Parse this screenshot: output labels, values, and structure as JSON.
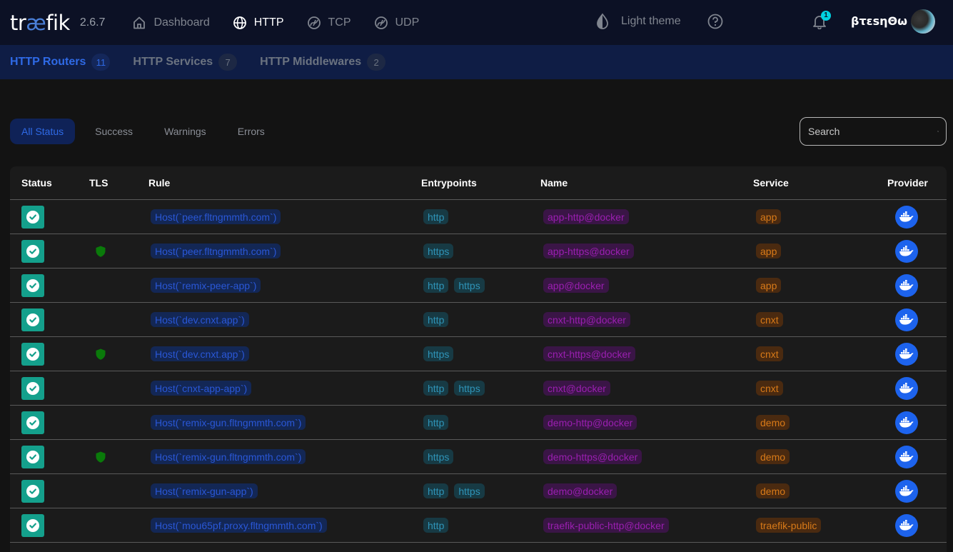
{
  "header": {
    "logo_prefix": "tr",
    "logo_ae": "æ",
    "logo_suffix": "fik",
    "version": "2.6.7",
    "nav": [
      {
        "label": "Dashboard",
        "icon": "home-icon",
        "active": false
      },
      {
        "label": "HTTP",
        "icon": "globe-icon",
        "active": true
      },
      {
        "label": "TCP",
        "icon": "tcp-icon",
        "active": false
      },
      {
        "label": "UDP",
        "icon": "udp-icon",
        "active": false
      }
    ],
    "theme_toggle_label": "Light theme",
    "notification_count": "1",
    "username": "βτεsηΘω"
  },
  "subnav": {
    "tabs": [
      {
        "label": "HTTP Routers",
        "count": "11",
        "active": true
      },
      {
        "label": "HTTP Services",
        "count": "7",
        "active": false
      },
      {
        "label": "HTTP Middlewares",
        "count": "2",
        "active": false
      }
    ]
  },
  "filters": {
    "options": [
      "All Status",
      "Success",
      "Warnings",
      "Errors"
    ],
    "selected": "All Status"
  },
  "search": {
    "placeholder": "Search",
    "value": ""
  },
  "colors": {
    "accent": "#2f6ae6",
    "success": "#14a08c",
    "tls_shield": "#0a7a0a",
    "docker_blue": "#1d63ed"
  },
  "table": {
    "columns": [
      "Status",
      "TLS",
      "Rule",
      "Entrypoints",
      "Name",
      "Service",
      "Provider"
    ],
    "rows": [
      {
        "status": "success",
        "tls": false,
        "rule": "Host(`peer.fltngmmth.com`)",
        "entrypoints": [
          "http"
        ],
        "name": "app-http@docker",
        "service": "app",
        "provider": "docker"
      },
      {
        "status": "success",
        "tls": true,
        "rule": "Host(`peer.fltngmmth.com`)",
        "entrypoints": [
          "https"
        ],
        "name": "app-https@docker",
        "service": "app",
        "provider": "docker"
      },
      {
        "status": "success",
        "tls": false,
        "rule": "Host(`remix-peer-app`)",
        "entrypoints": [
          "http",
          "https"
        ],
        "name": "app@docker",
        "service": "app",
        "provider": "docker"
      },
      {
        "status": "success",
        "tls": false,
        "rule": "Host(`dev.cnxt.app`)",
        "entrypoints": [
          "http"
        ],
        "name": "cnxt-http@docker",
        "service": "cnxt",
        "provider": "docker"
      },
      {
        "status": "success",
        "tls": true,
        "rule": "Host(`dev.cnxt.app`)",
        "entrypoints": [
          "https"
        ],
        "name": "cnxt-https@docker",
        "service": "cnxt",
        "provider": "docker"
      },
      {
        "status": "success",
        "tls": false,
        "rule": "Host(`cnxt-app-app`)",
        "entrypoints": [
          "http",
          "https"
        ],
        "name": "cnxt@docker",
        "service": "cnxt",
        "provider": "docker"
      },
      {
        "status": "success",
        "tls": false,
        "rule": "Host(`remix-gun.fltngmmth.com`)",
        "entrypoints": [
          "http"
        ],
        "name": "demo-http@docker",
        "service": "demo",
        "provider": "docker"
      },
      {
        "status": "success",
        "tls": true,
        "rule": "Host(`remix-gun.fltngmmth.com`)",
        "entrypoints": [
          "https"
        ],
        "name": "demo-https@docker",
        "service": "demo",
        "provider": "docker"
      },
      {
        "status": "success",
        "tls": false,
        "rule": "Host(`remix-gun-app`)",
        "entrypoints": [
          "http",
          "https"
        ],
        "name": "demo@docker",
        "service": "demo",
        "provider": "docker"
      },
      {
        "status": "success",
        "tls": false,
        "rule": "Host(`mou65pf.proxy.fltngmmth.com`)",
        "entrypoints": [
          "http"
        ],
        "name": "traefik-public-http@docker",
        "service": "traefik-public",
        "provider": "docker"
      }
    ]
  }
}
